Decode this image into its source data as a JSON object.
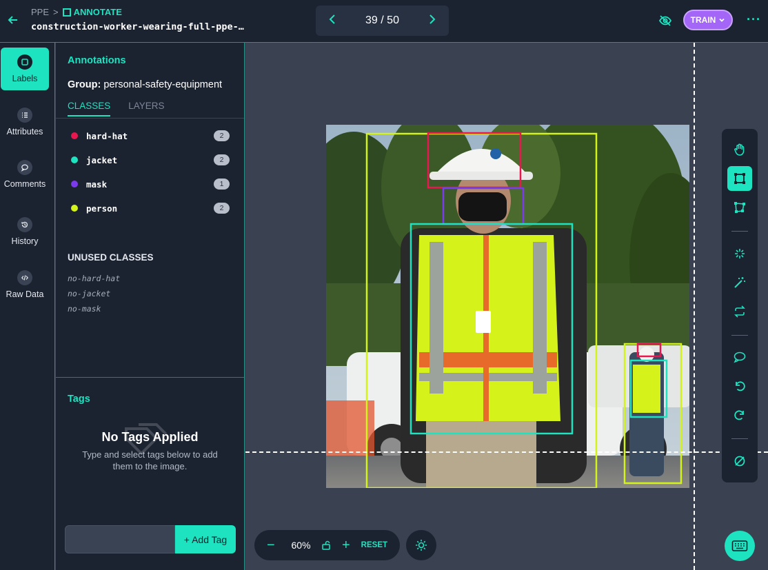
{
  "header": {
    "breadcrumb_project": "PPE",
    "breadcrumb_sep": ">",
    "breadcrumb_mode": "ANNOTATE",
    "filename": "construction-worker-wearing-full-ppe-…",
    "pager_count": "39 / 50",
    "train_label": "TRAIN"
  },
  "leftnav": {
    "items": [
      {
        "label": "Labels"
      },
      {
        "label": "Attributes"
      },
      {
        "label": "Comments"
      },
      {
        "label": "History"
      },
      {
        "label": "Raw Data"
      }
    ]
  },
  "panel": {
    "title": "Annotations",
    "group_prefix": "Group:",
    "group_name": "personal-safety-equipment",
    "tabs": [
      "CLASSES",
      "LAYERS"
    ],
    "classes": [
      {
        "name": "hard-hat",
        "count": "2",
        "color": "#e8174f"
      },
      {
        "name": "jacket",
        "count": "2",
        "color": "#1ee3c1"
      },
      {
        "name": "mask",
        "count": "1",
        "color": "#7c3aed"
      },
      {
        "name": "person",
        "count": "2",
        "color": "#d4f31a"
      }
    ],
    "unused_title": "UNUSED CLASSES",
    "unused": [
      "no-hard-hat",
      "no-jacket",
      "no-mask"
    ],
    "tags_title": "Tags",
    "no_tags_title": "No Tags Applied",
    "no_tags_sub": "Type and select tags below to add them to the image.",
    "tag_input_value": "",
    "add_tag_label": "+ Add Tag"
  },
  "canvas": {
    "zoom": "60%",
    "reset_label": "RESET"
  },
  "colors": {
    "accent": "#1ee3c1",
    "train": "#a366f7",
    "hard_hat": "#e8174f",
    "jacket": "#1ee3c1",
    "mask": "#7c3aed",
    "person": "#d4f31a"
  }
}
